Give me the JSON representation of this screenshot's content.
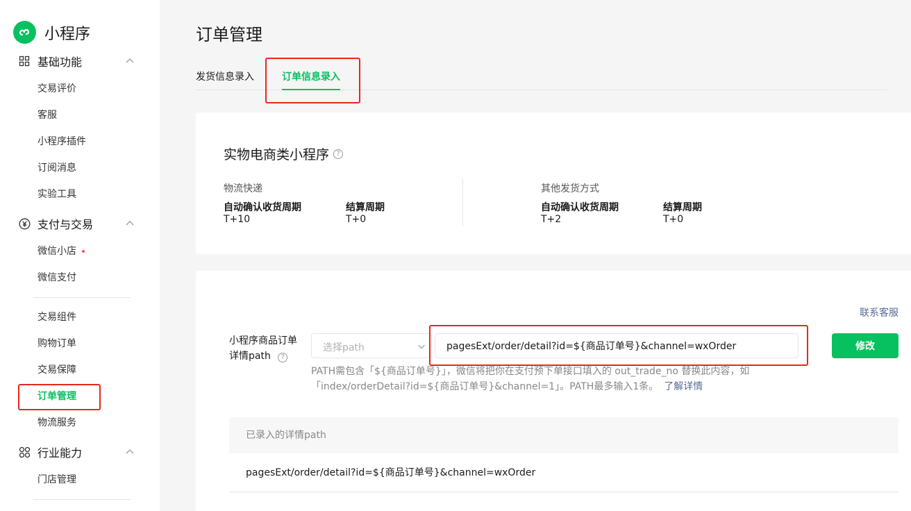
{
  "app": {
    "title": "小程序"
  },
  "sidebar": {
    "groups": [
      {
        "label": "基础功能",
        "items": [
          "交易评价",
          "客服",
          "小程序插件",
          "订阅消息",
          "实验工具"
        ]
      },
      {
        "label": "支付与交易",
        "items": [
          "微信小店",
          "微信支付",
          "交易组件",
          "购物订单",
          "交易保障",
          "订单管理",
          "物流服务"
        ]
      },
      {
        "label": "行业能力",
        "items": [
          "门店管理"
        ]
      }
    ],
    "active_item": "订单管理"
  },
  "page": {
    "title": "订单管理"
  },
  "tabs": [
    "发货信息录入",
    "订单信息录入"
  ],
  "active_tab": "订单信息录入",
  "card1": {
    "title": "实物电商类小程序",
    "sections": [
      {
        "label": "物流快递",
        "fields": [
          {
            "label": "自动确认收货周期",
            "value": "T+10"
          },
          {
            "label": "结算周期",
            "value": "T+0"
          }
        ]
      },
      {
        "label": "其他发货方式",
        "fields": [
          {
            "label": "自动确认收货周期",
            "value": "T+2"
          },
          {
            "label": "结算周期",
            "value": "T+0"
          }
        ]
      }
    ]
  },
  "card2": {
    "contact": "联系客服",
    "form_label": "小程序商品订单详情path",
    "select_placeholder": "选择path",
    "path_value": "pagesExt/order/detail?id=${商品订单号}&channel=wxOrder",
    "modify_button": "修改",
    "hint": "PATH需包含「${商品订单号}」，微信将把你在支付预下单接口填入的 out_trade_no 替换此内容，如「index/orderDetail?id=${商品订单号}&channel=1」。PATH最多输入1条。",
    "hint_link": "了解详情",
    "table_header": "已录入的详情path",
    "table_rows": [
      "pagesExt/order/detail?id=${商品订单号}&channel=wxOrder"
    ]
  },
  "colors": {
    "accent": "#07c160",
    "highlight": "#e8261a",
    "link": "#576b95"
  },
  "icons": [
    "miniprogram-logo-icon",
    "grid-icon",
    "yen-icon",
    "industry-icon",
    "chevron-up-icon",
    "chevron-down-icon",
    "help-icon"
  ]
}
